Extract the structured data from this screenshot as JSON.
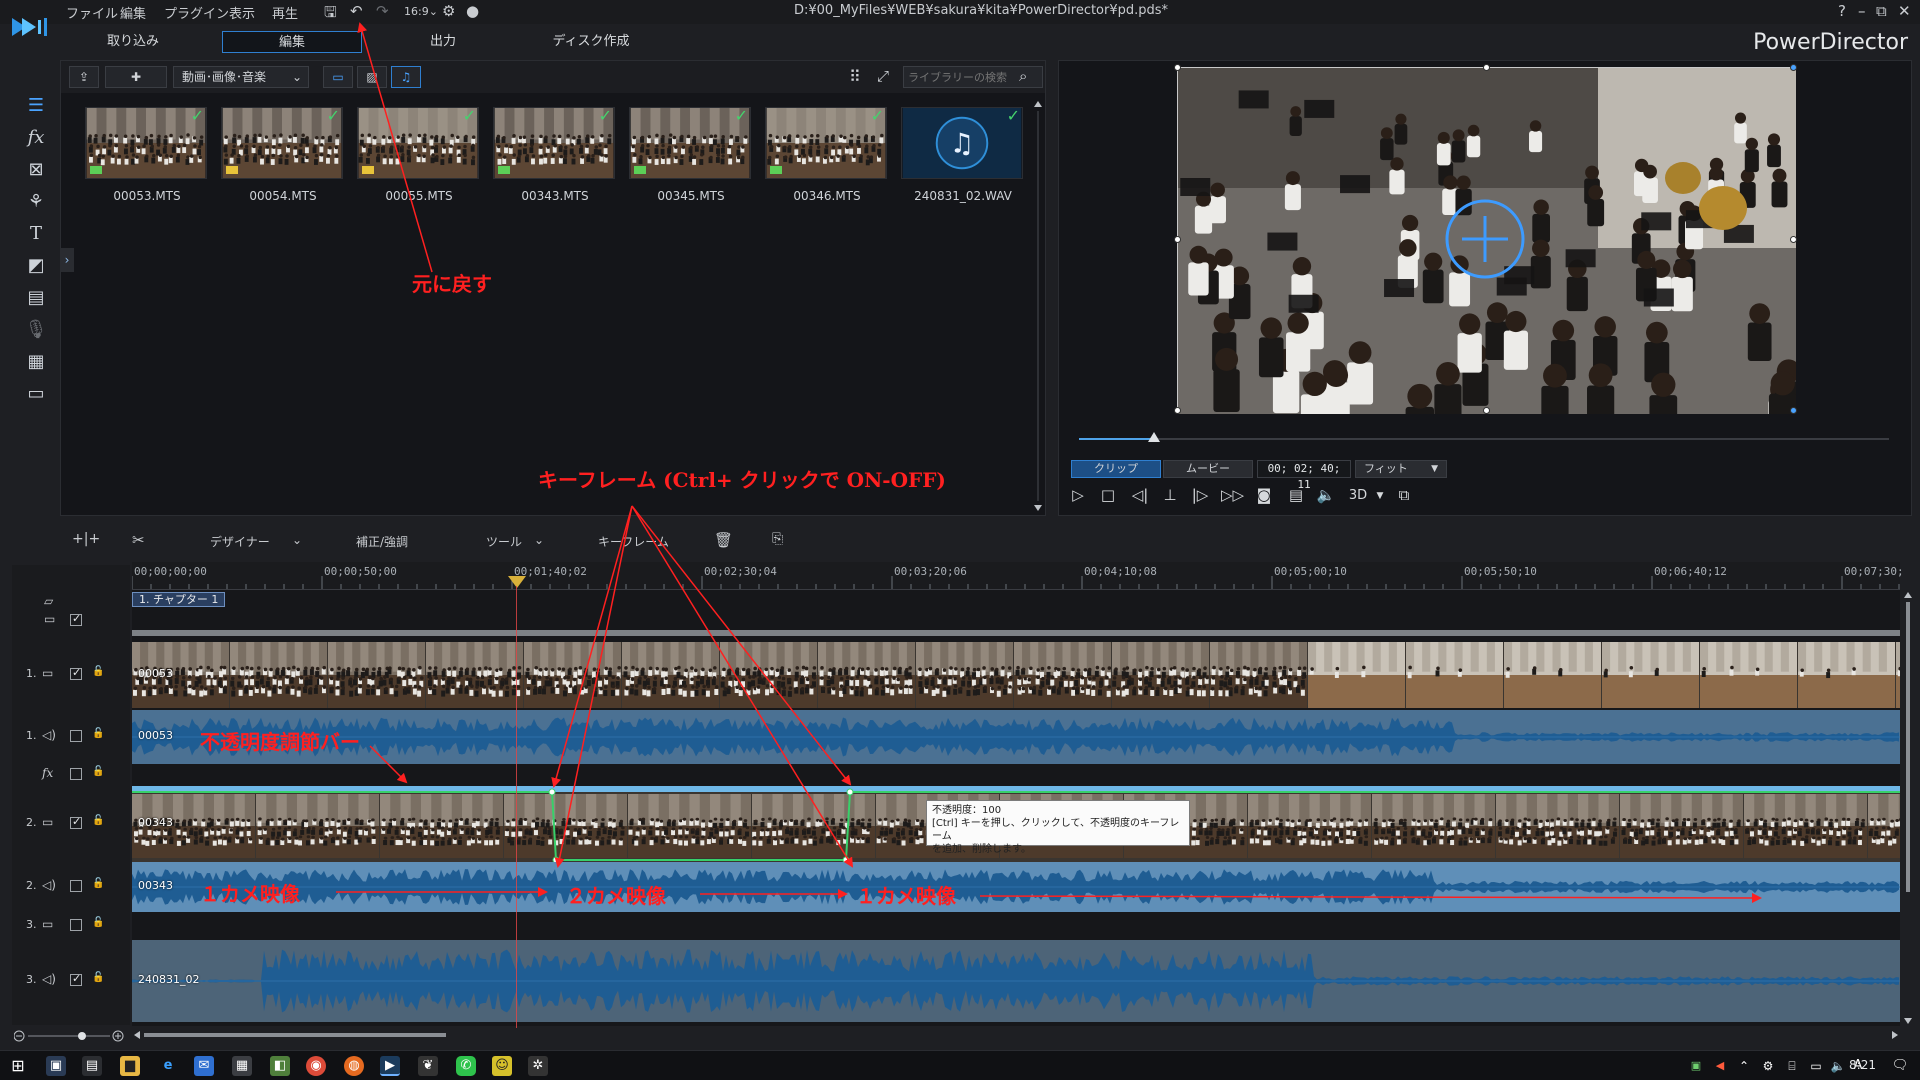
{
  "titlebar": {
    "menus": [
      "ファイル",
      "編集",
      "プラグイン",
      "表示",
      "再生"
    ],
    "file_path": "D:¥00_MyFiles¥WEB¥sakura¥kita¥PowerDirector¥pd.pds*",
    "window_buttons": [
      "?",
      "–",
      "⧉",
      "✕"
    ]
  },
  "rooms": {
    "tabs": [
      "取り込み",
      "編集",
      "出力",
      "ディスク作成"
    ],
    "active": "編集",
    "brand": "PowerDirector"
  },
  "library": {
    "filter": "動画･画像･音楽",
    "search_placeholder": "ライブラリーの検索",
    "items": [
      {
        "name": "00053.MTS",
        "checked": true
      },
      {
        "name": "00054.MTS",
        "checked": true
      },
      {
        "name": "00055.MTS",
        "checked": true
      },
      {
        "name": "00343.MTS",
        "checked": true
      },
      {
        "name": "00345.MTS",
        "checked": true
      },
      {
        "name": "00346.MTS",
        "checked": true
      },
      {
        "name": "240831_02.WAV",
        "checked": true
      }
    ]
  },
  "preview": {
    "mode_clip": "クリップ",
    "mode_movie": "ムービー",
    "timecode": "00; 02; 40; 11",
    "fit": "フィット",
    "three_d": "3D",
    "scrub_progress": 0.09
  },
  "timeline_toolbar": {
    "designer": "デザイナー",
    "correction": "補正/強調",
    "tools": "ツール",
    "keyframe": "キーフレーム"
  },
  "ruler": {
    "ticks": [
      "00;00;00;00",
      "00;00;50;00",
      "00;01;40;02",
      "00;02;30;04",
      "00;03;20;06",
      "00;04;10;08",
      "00;05;00;10",
      "00;05;50;10",
      "00;06;40;12",
      "00;07;30;"
    ]
  },
  "tracks": {
    "chapter": "1. チャプター 1",
    "rows": [
      {
        "label": "1.",
        "kind": "video",
        "clip": "00053"
      },
      {
        "label": "1.",
        "kind": "audio",
        "clip": "00053"
      },
      {
        "label": "",
        "kind": "fx",
        "clip": ""
      },
      {
        "label": "2.",
        "kind": "video",
        "clip": "00343"
      },
      {
        "label": "2.",
        "kind": "audio",
        "clip": "00343"
      },
      {
        "label": "3.",
        "kind": "video",
        "clip": ""
      },
      {
        "label": "3.",
        "kind": "audio",
        "clip": "240831_02"
      }
    ]
  },
  "tooltip": {
    "line1": "不透明度：100",
    "line2": "[Ctrl] キーを押し、クリックして、不透明度のキーフレーム",
    "line3": "を追加、削除します。"
  },
  "annotations": {
    "undo": "元に戻す",
    "keyframe": "キーフレーム (Ctrl+ クリックで ON-OFF)",
    "opacity_bar": "不透明度調節バー",
    "cam1_a": "１カメ映像",
    "cam2": "２カメ映像",
    "cam1_b": "１カメ映像"
  },
  "taskbar": {
    "clock": "8:21",
    "ime": "A"
  },
  "colors": {
    "accent": "#2f7fd0",
    "annotation": "#ff2020",
    "audio_wave": "#1f5d93",
    "check": "#45d36d"
  }
}
